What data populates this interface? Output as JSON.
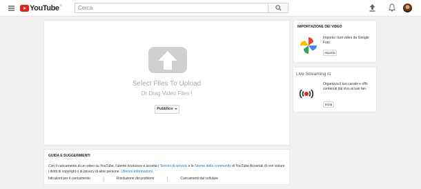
{
  "header": {
    "logo_text": "YouTube",
    "logo_country": "IT",
    "search_placeholder": "Cerca"
  },
  "upload": {
    "title": "Select Files To Upload",
    "subtitle": "Or Drag Video Files !",
    "privacy_label": "Pubblico"
  },
  "guide": {
    "title": "GUIDA E SUGGERIMENTI",
    "text_part1": "Con il caricamento di un video su YouTube, l'utente riconosce e accetta i ",
    "terms_link": "Termini di servizio",
    "text_part2": " e le ",
    "community_link": "Norme della community",
    "text_part3": " di YouTube Accertati di non violare i diritti di copyright o di privacy di altre persone. ",
    "more_link": "Ulteriori informazioni",
    "links": [
      "Istruzioni per il caricamento",
      "Risoluzione dei problemi",
      "Caricamenti dal cellulare"
    ]
  },
  "import": {
    "title": "IMPORTAZIONE DEI VIDEO",
    "text": "Importa i tuoi video da Google Foto",
    "button": "Importa"
  },
  "live": {
    "title": "Live Streaming",
    "beta": "IG",
    "text": "Organizza il tuo canale e offri contenuti dal vivo ai tuoi fan.",
    "button": "Inizia"
  },
  "colors": {
    "brand_red": "#e62117",
    "link_blue": "#167ac6",
    "background": "#f1f1f1"
  },
  "icons": [
    "menu-icon",
    "search-icon",
    "upload-icon",
    "bell-icon",
    "cloud-upload-icon",
    "google-photos-icon",
    "live-stream-icon"
  ]
}
